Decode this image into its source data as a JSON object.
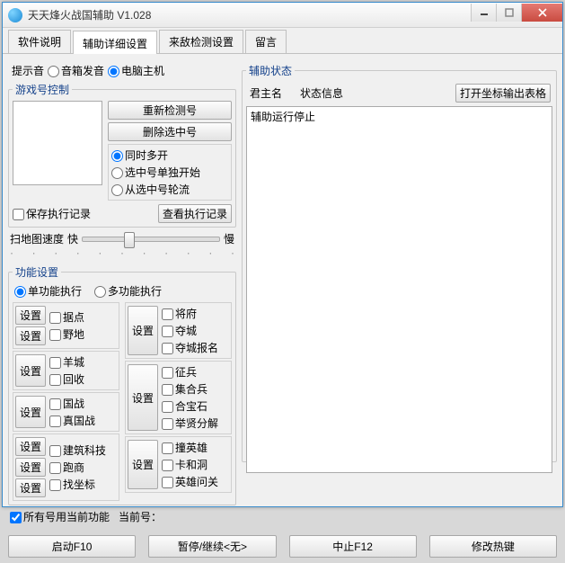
{
  "window": {
    "title": "天天烽火战国辅助 V1.028"
  },
  "tabs": [
    "软件说明",
    "辅助详细设置",
    "来敌检测设置",
    "留言"
  ],
  "sound": {
    "label": "提示音",
    "opt1": "音箱发音",
    "opt2": "电脑主机"
  },
  "accountCtrl": {
    "legend": "游戏号控制",
    "btn_redetect": "重新检测号",
    "btn_delete": "删除选中号",
    "r1": "同时多开",
    "r2": "选中号单独开始",
    "r3": "从选中号轮流",
    "save_chk": "保存执行记录",
    "view_btn": "查看执行记录"
  },
  "scan": {
    "label": "扫地图速度",
    "fast": "快",
    "slow": "慢"
  },
  "features": {
    "legend": "功能设置",
    "mode1": "单功能执行",
    "mode2": "多功能执行",
    "set_btn": "设置",
    "left": {
      "g1": [
        "据点",
        "野地"
      ],
      "g2": [
        "羊城",
        "回收"
      ],
      "g3": [
        "国战",
        "真国战"
      ],
      "g4": [
        "建筑科技",
        "跑商",
        "找坐标"
      ]
    },
    "right": {
      "g1": [
        "将府",
        "夺城",
        "夺城报名"
      ],
      "g2": [
        "征兵",
        "集合兵",
        "合宝石",
        "举贤分解"
      ],
      "g3": [
        "撞英雄",
        "卡和洞",
        "英雄问关"
      ]
    }
  },
  "allUse": {
    "chk": "所有号用当前功能",
    "cur": "当前号："
  },
  "status": {
    "legend": "辅助状态",
    "col1": "君主名",
    "col2": "状态信息",
    "open_btn": "打开坐标输出表格",
    "msg": "辅助运行停止"
  },
  "bottom": {
    "start": "启动F10",
    "pause": "暂停/继续<无>",
    "stop": "中止F12",
    "hotkey": "修改热键"
  }
}
